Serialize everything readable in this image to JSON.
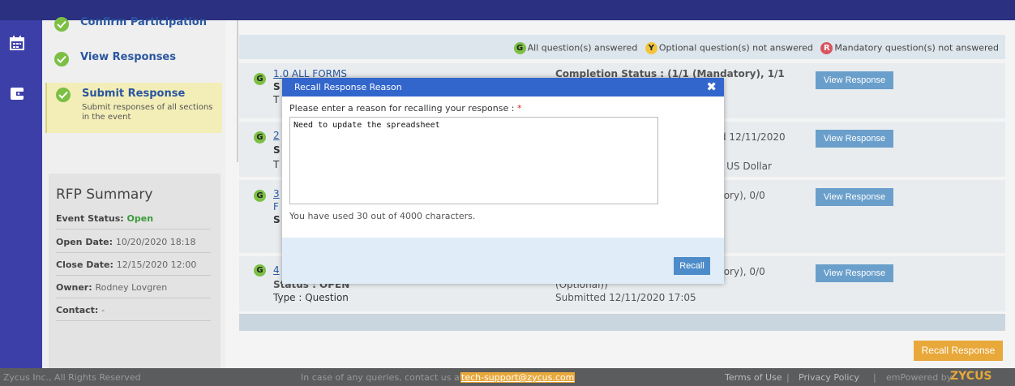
{
  "steps": [
    {
      "title": "Confirm Participation"
    },
    {
      "title": "View Responses"
    },
    {
      "title": "Submit Response",
      "subtitle": "Submit responses of all sections in the event"
    }
  ],
  "summary": {
    "title": "RFP Summary",
    "event_status_label": "Event Status:",
    "event_status_value": "Open",
    "open_date_label": "Open Date:",
    "open_date_value": "10/20/2020 18:18",
    "close_date_label": "Close Date:",
    "close_date_value": "12/15/2020 12:00",
    "owner_label": "Owner:",
    "owner_value": "Rodney Lovgren",
    "contact_label": "Contact:",
    "contact_value": "-"
  },
  "legend": {
    "g": "G",
    "g_text": "All question(s) answered",
    "y": "Y",
    "y_text": "Optional question(s) not answered",
    "r": "R",
    "r_text": "Mandatory question(s) not answered"
  },
  "cards": [
    {
      "badge": "G",
      "line1": "1.0 ALL FORMS",
      "line2": "S",
      "line3": "T",
      "status1": "Completion Status : (1/1 (Mandatory), 1/1",
      "status2": "",
      "status3": "",
      "button": "View Response"
    },
    {
      "badge": "G",
      "line1": "2",
      "line2": "S",
      "line3": "T",
      "status1": "d 12/11/2020",
      "status2": "",
      "status3": "- US Dollar",
      "button": "View Response"
    },
    {
      "badge": "G",
      "line1": "3",
      "line2": "F",
      "line3": "S",
      "status1": "tory), 0/0",
      "status2": "",
      "status3": "",
      "button": "View Response"
    },
    {
      "badge": "G",
      "line1": "4",
      "line2": "Status : OPEN",
      "line3": "Type : Question",
      "status1": "tory), 0/0",
      "status2": "(Optional))",
      "status3": "Submitted 12/11/2020 17:05",
      "button": "View Response"
    }
  ],
  "recall_button": "Recall Response",
  "footer": {
    "left": "Zycus Inc., All Rights Reserved",
    "query": "In case of any queries, contact us at",
    "email": "tech-support@zycus.com",
    "terms": "Terms of Use",
    "sep1": "|",
    "privacy": "Privacy Policy",
    "sep2": "|",
    "powered": "emPowered by",
    "brand": "ZYCUS"
  },
  "modal": {
    "title": "Recall Response Reason",
    "close": "✖",
    "label": "Please enter a reason for recalling your response :",
    "required": "*",
    "value": "Need to update the spreadsheet",
    "count": "You have used 30 out of 4000 characters.",
    "recall": "Recall"
  }
}
